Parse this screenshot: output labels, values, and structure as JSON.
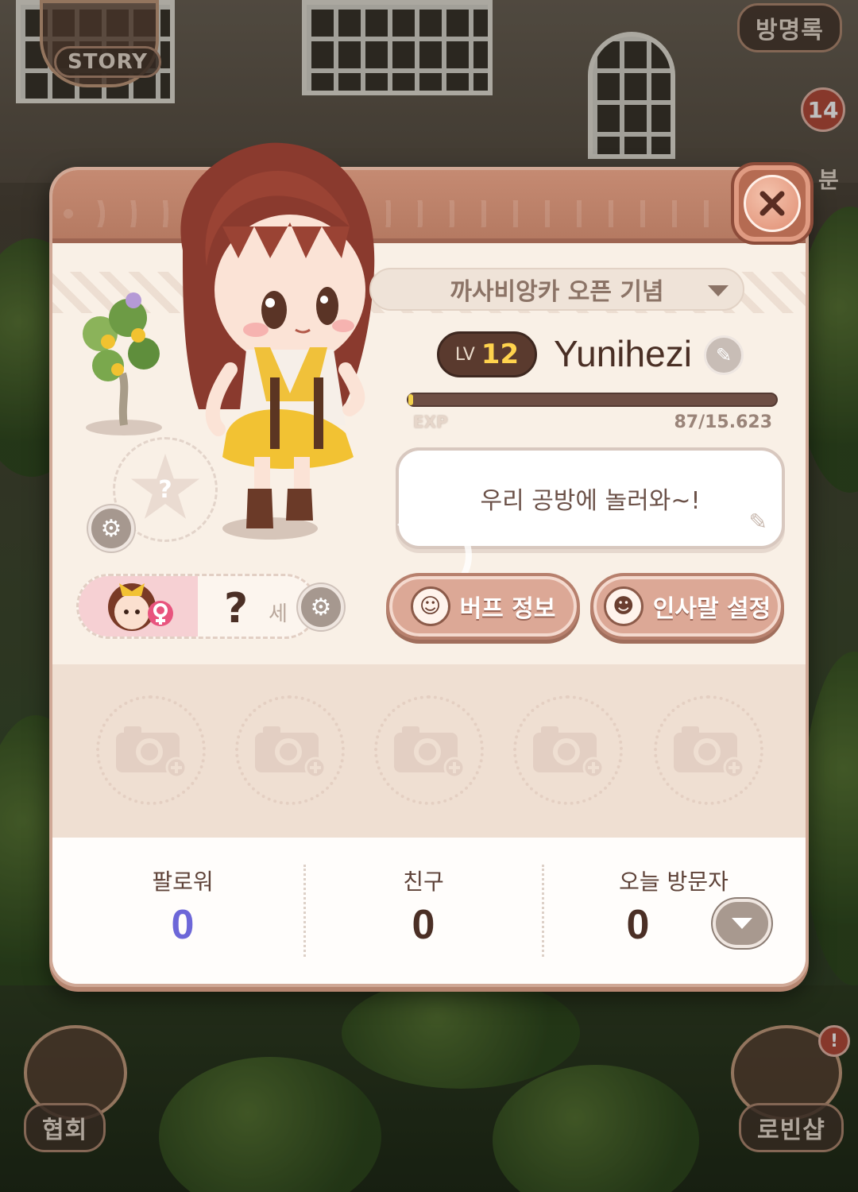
{
  "hud": {
    "story_label": "STORY",
    "guestbook_label": "방명록",
    "notification_count": "14",
    "side_label_partial": "분",
    "association_label": "협회",
    "robin_shop_label": "로빈샵"
  },
  "profile": {
    "title_dropdown": "까사비앙카 오픈 기념",
    "level_prefix": "LV",
    "level": "12",
    "player_name": "Yunihezi",
    "exp_label": "EXP",
    "exp_value": "87/15.623",
    "exp_fraction": 0.0056,
    "greeting": "우리 공방에 놀러와~!",
    "age_value": "?",
    "age_unit": "세",
    "pet_slot_symbol": "?"
  },
  "buttons": {
    "buff_info": "버프 정보",
    "greeting_settings": "인사말 설정"
  },
  "gallery": {
    "slots": [
      "camera-add",
      "camera-add",
      "camera-add",
      "camera-add",
      "camera-add"
    ]
  },
  "stats": {
    "followers_label": "팔로워",
    "followers_value": "0",
    "friends_label": "친구",
    "friends_value": "0",
    "visitors_label": "오늘 방문자",
    "visitors_value": "0"
  },
  "colors": {
    "header": "#b57a62",
    "panel": "#f9f0e6",
    "accent_gold": "#ffd34d",
    "follower_blue": "#6d67d8"
  }
}
